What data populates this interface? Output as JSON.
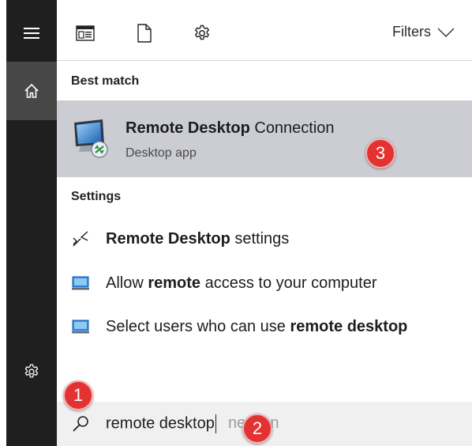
{
  "filters": {
    "label": "Filters"
  },
  "best_match": {
    "header": "Best match",
    "app_title_bold": "Remote Desktop",
    "app_title_rest": " Connection",
    "app_subtitle": "Desktop app"
  },
  "settings": {
    "header": "Settings",
    "items": [
      {
        "pre": "",
        "bold": "Remote Desktop",
        "post": " settings"
      },
      {
        "pre": "Allow ",
        "bold": "remote",
        "post": " access to your computer"
      },
      {
        "pre": "Select users who can use ",
        "bold": "remote desktop",
        "post": ""
      }
    ]
  },
  "search": {
    "query": "remote desktop",
    "suggestion_remainder": "nection"
  },
  "annotations": [
    "1",
    "2",
    "3"
  ],
  "colors": {
    "rail": "#1f1f1f",
    "rail_active": "#474747",
    "selection": "#cccdd3",
    "search_bg": "#f0f0f0",
    "badge": "#e33232"
  }
}
